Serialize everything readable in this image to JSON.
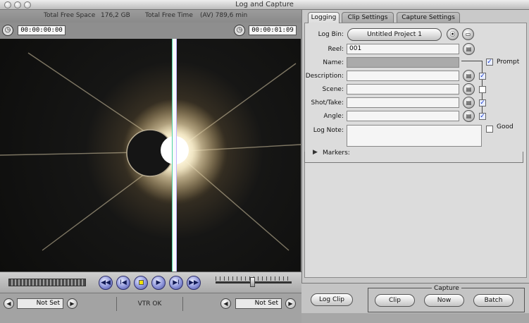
{
  "window": {
    "title": "Log and Capture"
  },
  "info": {
    "free_space_label": "Total Free Space",
    "free_space_value": "176,2 GB",
    "free_time_label": "Total Free Time",
    "free_time_value": "(AV) 789,6 min"
  },
  "timecode": {
    "current": "00:00:00:00",
    "duration": "00:00:01:09"
  },
  "bottom_left": {
    "in_point": "Not Set",
    "status": "VTR OK",
    "out_point": "Not Set"
  },
  "tabs": [
    "Logging",
    "Clip Settings",
    "Capture Settings"
  ],
  "logging": {
    "log_bin_label": "Log Bin:",
    "log_bin_value": "Untitled Project 1",
    "reel_label": "Reel:",
    "reel_value": "001",
    "name_label": "Name:",
    "name_value": "",
    "prompt_label": "Prompt",
    "description_label": "Description:",
    "description_value": "",
    "scene_label": "Scene:",
    "scene_value": "",
    "shot_label": "Shot/Take:",
    "shot_value": "",
    "angle_label": "Angle:",
    "angle_value": "",
    "lognote_label": "Log Note:",
    "lognote_value": "",
    "good_label": "Good",
    "markers_label": "Markers:"
  },
  "checks": {
    "prompt": true,
    "description": true,
    "scene": false,
    "shot": true,
    "angle": true,
    "good": false
  },
  "capture": {
    "log_clip": "Log Clip",
    "title": "Capture",
    "clip": "Clip",
    "now": "Now",
    "batch": "Batch"
  },
  "icons": {
    "rewind": "rewind-icon",
    "prev": "previous-edit-icon",
    "stop": "stop-icon",
    "play": "play-icon",
    "next": "next-edit-icon",
    "fast_forward": "fast-forward-icon"
  },
  "colors": {
    "transport_blue": "#8b93d8",
    "check_blue": "#1a3dcc"
  }
}
